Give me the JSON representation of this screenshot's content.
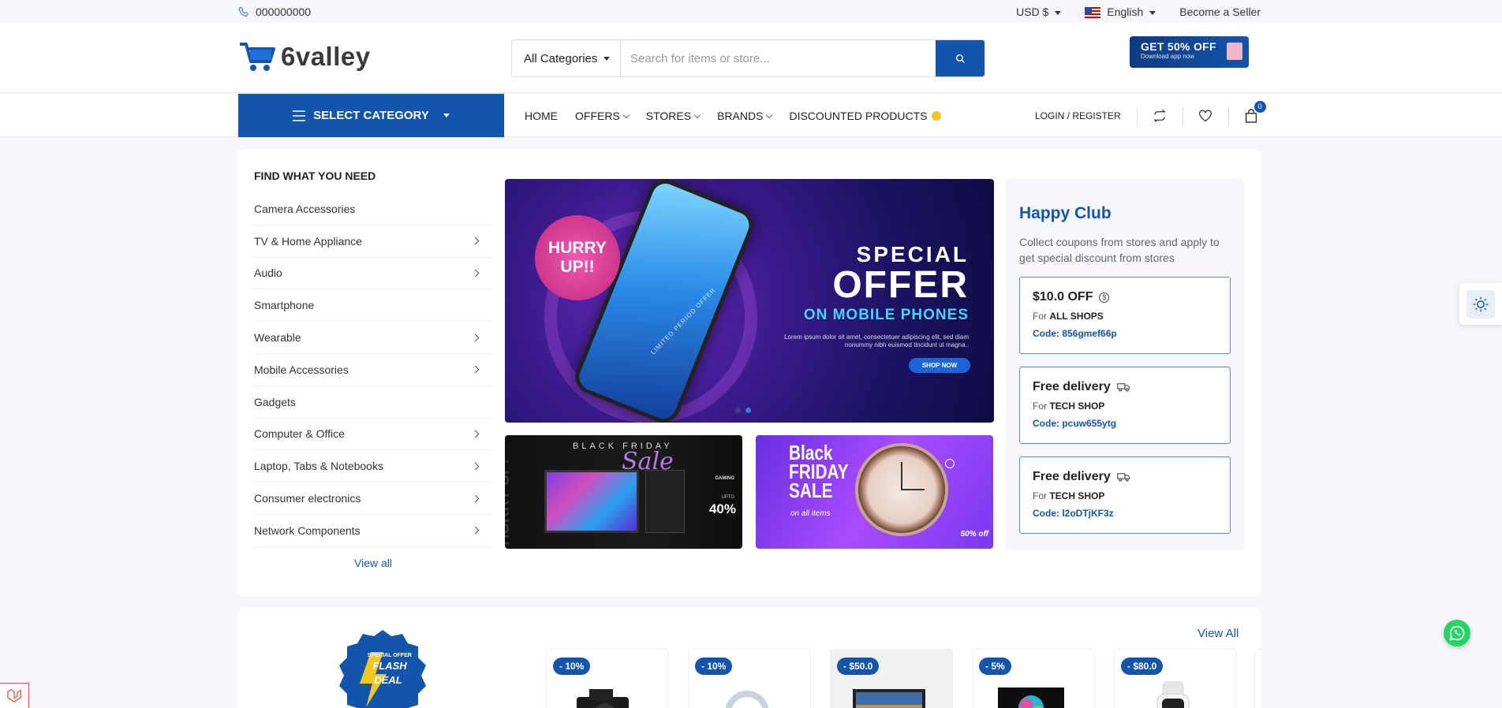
{
  "topbar": {
    "phone": "000000000",
    "currency": "USD $",
    "language": "English",
    "become_seller": "Become a Seller"
  },
  "header": {
    "logo_text": "6valley",
    "search": {
      "category": "All Categories",
      "placeholder": "Search for items or store..."
    },
    "app_banner": {
      "title": "GET 50% OFF",
      "subtitle": "Download app now"
    }
  },
  "nav": {
    "select_category": "SELECT CATEGORY",
    "menu": [
      "HOME",
      "OFFERS",
      "STORES",
      "BRANDS",
      "DISCOUNTED PRODUCTS"
    ],
    "login": "LOGIN / REGISTER",
    "cart_count": "0"
  },
  "categories": {
    "title": "FIND WHAT YOU NEED",
    "items": [
      "Camera Accessories",
      "TV & Home Appliance",
      "Audio",
      "Smartphone",
      "Wearable",
      "Mobile Accessories",
      "Gadgets",
      "Computer & Office",
      "Laptop, Tabs & Notebooks",
      "Consumer electronics",
      "Network Components"
    ],
    "view_all": "View all"
  },
  "hero": {
    "badge": "HURRY UP!!",
    "line1": "SPECIAL",
    "line2": "OFFER",
    "line3": "ON MOBILE PHONES",
    "body": "Lorem ipsum dolor sit amet, consectetuer adipiscing elit, sed diam nonummy nibh euismod tincidunt ut magna..",
    "cta": "SHOP NOW",
    "phone_text": "LIMITED PERIOD OFFER"
  },
  "promo1": {
    "top": "BLACK FRIDAY",
    "sale": "Sale",
    "gaming": "GAMING",
    "upto": "UPTO",
    "percent": "40%",
    "side": "HURRY UP!"
  },
  "promo2": {
    "title": "Black FRIDAY SALE",
    "sub": "on all items",
    "off": "50% off"
  },
  "club": {
    "title": "Happy Club",
    "description": "Collect coupons from stores and apply to get special discount from stores",
    "coupons": [
      {
        "title": "$10.0 OFF",
        "for": "For",
        "shop": "ALL SHOPS",
        "code": "Code: 856gmef66p",
        "icon": "dollar-circle-icon"
      },
      {
        "title": "Free delivery",
        "for": "For",
        "shop": "TECH SHOP",
        "code": "Code: pcuw655ytg",
        "icon": "truck-icon"
      },
      {
        "title": "Free delivery",
        "for": "For",
        "shop": "TECH SHOP",
        "code": "Code: l2oDTjKF3z",
        "icon": "truck-icon"
      }
    ]
  },
  "flash": {
    "view_all": "View All",
    "badge_top": "SPECIAL OFFER",
    "badge_line1": "FLASH",
    "badge_line2": "DEAL",
    "products": [
      {
        "discount": "- 10%"
      },
      {
        "discount": "- 10%"
      },
      {
        "discount": "- $50.0"
      },
      {
        "discount": "- 5%"
      },
      {
        "discount": "- $80.0"
      }
    ]
  },
  "colors": {
    "primary": "#1455ac",
    "accent_yellow": "#f3c623",
    "whatsapp": "#25d366"
  }
}
